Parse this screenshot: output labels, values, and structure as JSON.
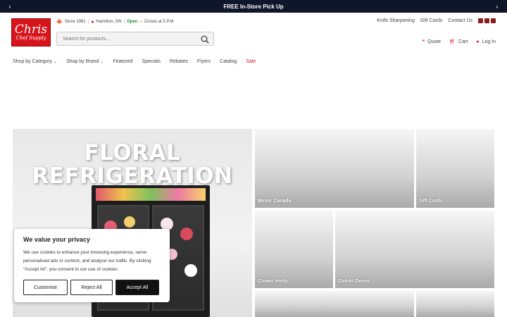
{
  "announcement": {
    "text": "FREE In-Store Pick Up",
    "prev": "‹",
    "next": "›"
  },
  "logo": {
    "line1": "Chris",
    "line2": "Chef Supply"
  },
  "meta": {
    "since": "Since 1961",
    "location": "Hamilton, ON",
    "status": "Open",
    "hours": "Closes at 5 P.M"
  },
  "search": {
    "placeholder": "Search for products..."
  },
  "top_links": [
    "Knife Sharpening",
    "Gift Cards",
    "Contact Us"
  ],
  "user_links": {
    "quote": "Quote",
    "cart": "Cart",
    "login": "Log In"
  },
  "nav": {
    "shop_by_category": "Shop by Category",
    "shop_by_brand": "Shop by Brand",
    "featured": "Featured",
    "specials": "Specials",
    "rebates": "Rebates",
    "flyers": "Flyers",
    "catalog": "Catalog",
    "sale": "Sale"
  },
  "hero": {
    "title_line1": "FLORAL",
    "title_line2": "REFRIGERATION",
    "next": "›"
  },
  "tiles": [
    "Meyer Canada",
    "Gift Cards",
    "Crown Verity",
    "Combi Ovens",
    "",
    ""
  ],
  "cookie": {
    "title": "We value your privacy",
    "body": "We use cookies to enhance your browsing experience, serve personalised ads or content, and analyse our traffic. By clicking \"Accept All\", you consent to our use of cookies.",
    "customise": "Customise",
    "reject": "Reject All",
    "accept": "Accept All"
  },
  "colors": {
    "brand_red": "#d6141c",
    "topbar": "#0f1629",
    "open_green": "#1a8b3a"
  }
}
